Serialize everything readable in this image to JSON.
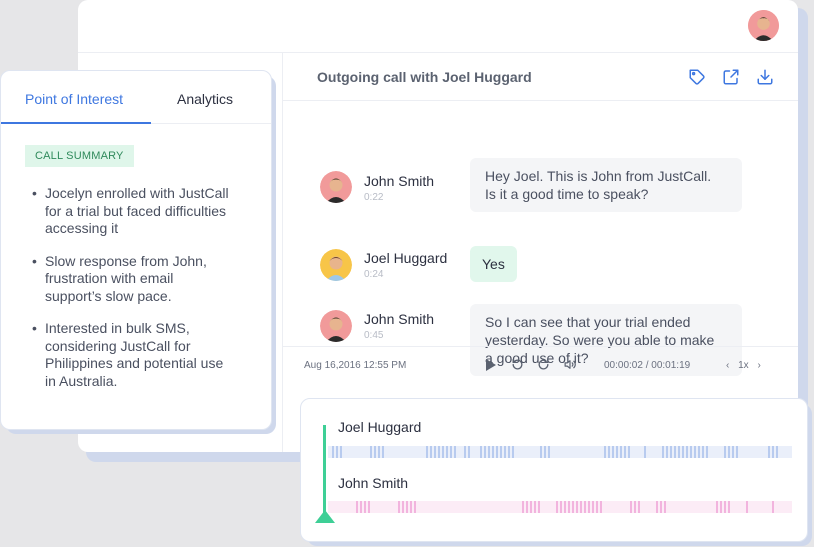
{
  "call": {
    "title": "Outgoing call with Joel Huggard",
    "header_icons": [
      "tag-icon",
      "share-icon",
      "download-icon"
    ]
  },
  "messages": [
    {
      "speaker": "John Smith",
      "time": "0:22",
      "text_lines": [
        "Hey Joel. This is John from JustCall.",
        "Is it a good time to speak?"
      ],
      "style": "grey"
    },
    {
      "speaker": "Joel Huggard",
      "time": "0:24",
      "text_lines": [
        "Yes"
      ],
      "style": "green"
    },
    {
      "speaker": "John Smith",
      "time": "0:45",
      "text_lines": [
        "So I can see that your trial ended",
        "yesterday. So were you able to make",
        "a good use of it?"
      ],
      "style": "grey"
    }
  ],
  "player": {
    "date": "Aug 16,2016 12:55 PM",
    "timecode": "00:00:02 / 00:01:19",
    "speed": "1x",
    "controls": [
      "play-icon",
      "rewind-icon",
      "forward-icon",
      "volume-icon"
    ]
  },
  "panel": {
    "tabs": [
      {
        "label": "Point of Interest",
        "active": true
      },
      {
        "label": "Analytics",
        "active": false
      }
    ],
    "badge": "CALL SUMMARY",
    "summary": [
      [
        "Jocelyn enrolled with JustCall",
        "for a trial but faced difficulties",
        "accessing it"
      ],
      [
        "Slow response from John,",
        "frustration with email",
        "support’s slow pace."
      ],
      [
        "Interested in bulk SMS,",
        "considering JustCall for",
        "Philippines and potential use",
        "in Australia."
      ]
    ]
  },
  "waveform": {
    "speakers": [
      {
        "name": "Joel Huggard",
        "color": "#b8cbef"
      },
      {
        "name": "John Smith",
        "color": "#f2b4de"
      }
    ]
  },
  "colors": {
    "accent": "#3e77e0",
    "success": "#3ecf96"
  }
}
